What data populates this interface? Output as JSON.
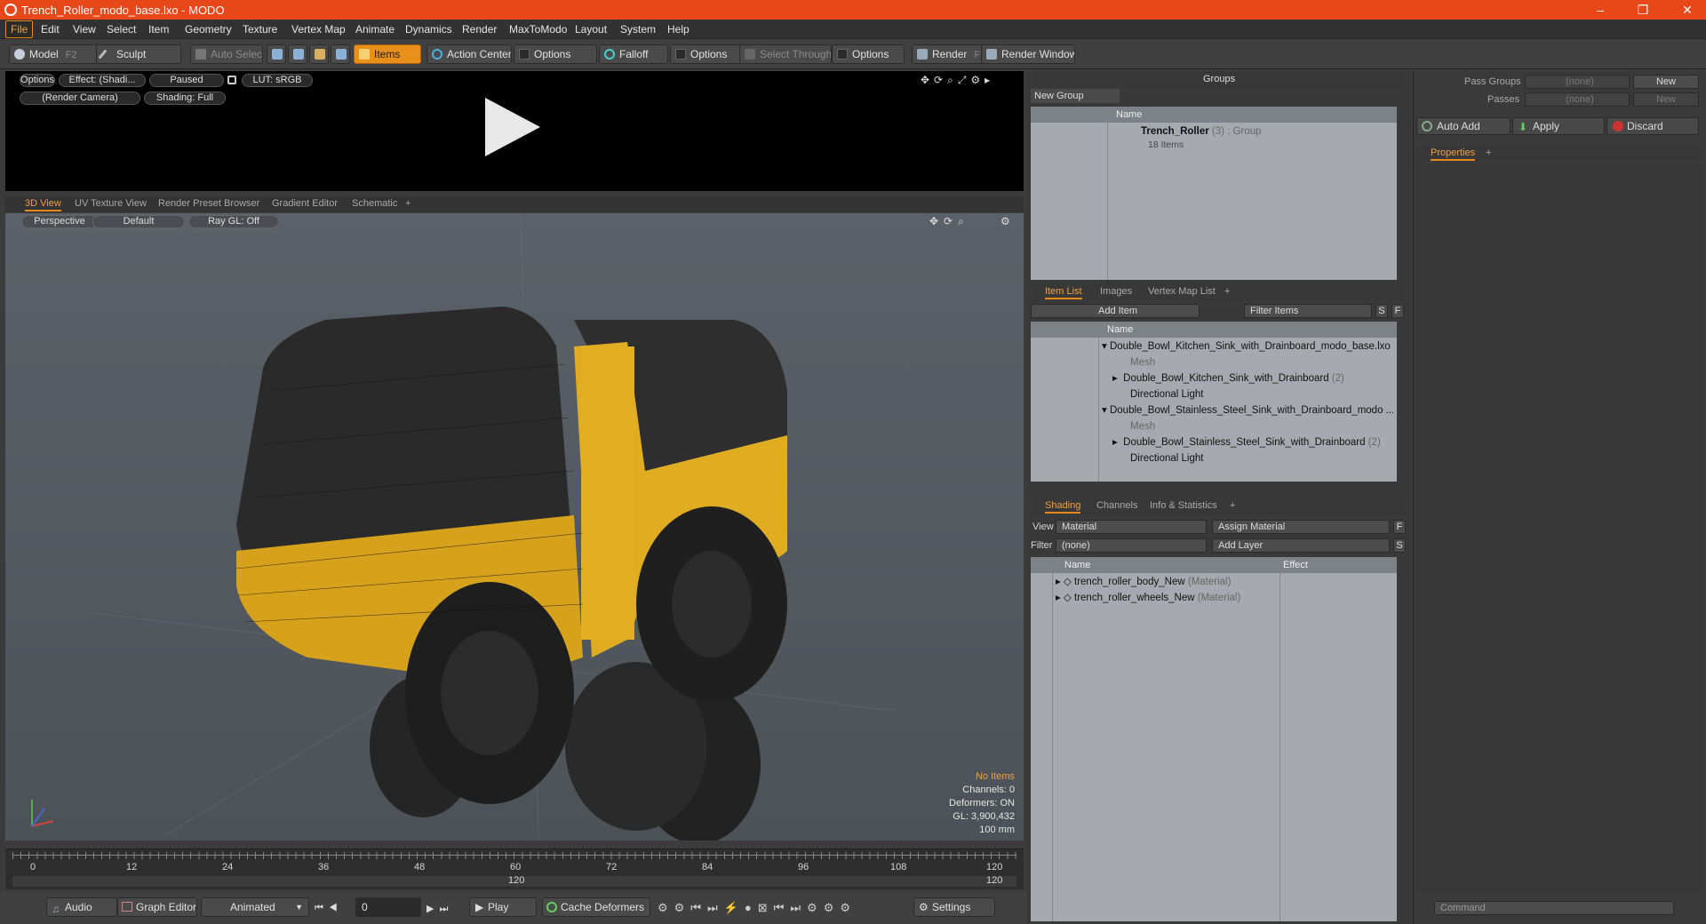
{
  "window": {
    "title": "Trench_Roller_modo_base.lxo - MODO",
    "minimize": "–",
    "maximize": "❐",
    "close": "✕"
  },
  "menu": [
    "File",
    "Edit",
    "View",
    "Select",
    "Item",
    "Geometry",
    "Texture",
    "Vertex Map",
    "Animate",
    "Dynamics",
    "Render",
    "MaxToModo",
    "Layout",
    "System",
    "Help"
  ],
  "toolbar": {
    "model": "Model",
    "model_key": "F2",
    "sculpt": "Sculpt",
    "auto_select": "Auto Select",
    "items": "Items",
    "action_center": "Action Center",
    "options1": "Options",
    "falloff": "Falloff",
    "options2": "Options",
    "select_through": "Select Through",
    "options3": "Options",
    "render": "Render",
    "render_key": "F9",
    "render_window": "Render Window"
  },
  "render_preview": {
    "options": "Options",
    "effect": "Effect: (Shadi...",
    "paused": "Paused",
    "lut": "LUT: sRGB",
    "camera": "(Render Camera)",
    "shading": "Shading: Full"
  },
  "viewport_tabs": [
    "3D View",
    "UV Texture View",
    "Render Preset Browser",
    "Gradient Editor",
    "Schematic",
    "+"
  ],
  "viewport": {
    "perspective": "Perspective",
    "default": "Default",
    "raygl": "Ray GL: Off",
    "stats": {
      "no_items": "No Items",
      "channels": "Channels: 0",
      "deformers": "Deformers: ON",
      "gl": "GL: 3,900,432",
      "scale": "100 mm"
    }
  },
  "timeline": {
    "ticks": [
      "0",
      "12",
      "24",
      "36",
      "48",
      "60",
      "72",
      "84",
      "96",
      "108",
      "120"
    ],
    "end_left": "120",
    "end_right": "120"
  },
  "bottombar": {
    "audio": "Audio",
    "graph_editor": "Graph Editor",
    "animated": "Animated",
    "frame": "0",
    "play": "Play",
    "cache_deformers": "Cache Deformers",
    "settings": "Settings"
  },
  "groups": {
    "title": "Groups",
    "new_group": "New Group",
    "col_name": "Name",
    "item_name": "Trench_Roller",
    "item_count": "(3)",
    "item_type": ": Group",
    "item_sub": "18 Items"
  },
  "itemlist": {
    "tabs": [
      "Item List",
      "Images",
      "Vertex Map List",
      "+"
    ],
    "add_item": "Add Item",
    "filter_items": "Filter Items",
    "s": "S",
    "f": "F",
    "col_name": "Name",
    "rows": [
      {
        "text": "Double_Bowl_Kitchen_Sink_with_Drainboard_modo_base.lxo",
        "count": "",
        "indent": 0,
        "gray": false
      },
      {
        "text": "Mesh",
        "count": "",
        "indent": 2,
        "gray": true
      },
      {
        "text": "Double_Bowl_Kitchen_Sink_with_Drainboard",
        "count": "(2)",
        "indent": 2,
        "gray": false
      },
      {
        "text": "Directional Light",
        "count": "",
        "indent": 2,
        "gray": false
      },
      {
        "text": "Double_Bowl_Stainless_Steel_Sink_with_Drainboard_modo ...",
        "count": "",
        "indent": 0,
        "gray": false
      },
      {
        "text": "Mesh",
        "count": "",
        "indent": 2,
        "gray": true
      },
      {
        "text": "Double_Bowl_Stainless_Steel_Sink_with_Drainboard",
        "count": "(2)",
        "indent": 2,
        "gray": false
      },
      {
        "text": "Directional Light",
        "count": "",
        "indent": 2,
        "gray": false
      }
    ]
  },
  "shading": {
    "tabs": [
      "Shading",
      "Channels",
      "Info & Statistics",
      "+"
    ],
    "view_label": "View",
    "view_value": "Material",
    "assign_material": "Assign Material",
    "f": "F",
    "filter_label": "Filter",
    "filter_value": "(none)",
    "add_layer": "Add Layer",
    "s": "S",
    "col_name": "Name",
    "col_effect": "Effect",
    "rows": [
      {
        "name": "trench_roller_body_New",
        "type": "(Material)"
      },
      {
        "name": "trench_roller_wheels_New",
        "type": "(Material)"
      }
    ]
  },
  "right": {
    "pass_groups": "Pass Groups",
    "pass_groups_value": "(none)",
    "new": "New",
    "passes": "Passes",
    "passes_value": "(none)",
    "new2": "New",
    "auto_add": "Auto Add",
    "apply": "Apply",
    "discard": "Discard",
    "properties": "Properties",
    "plus": "+",
    "command": "Command"
  }
}
